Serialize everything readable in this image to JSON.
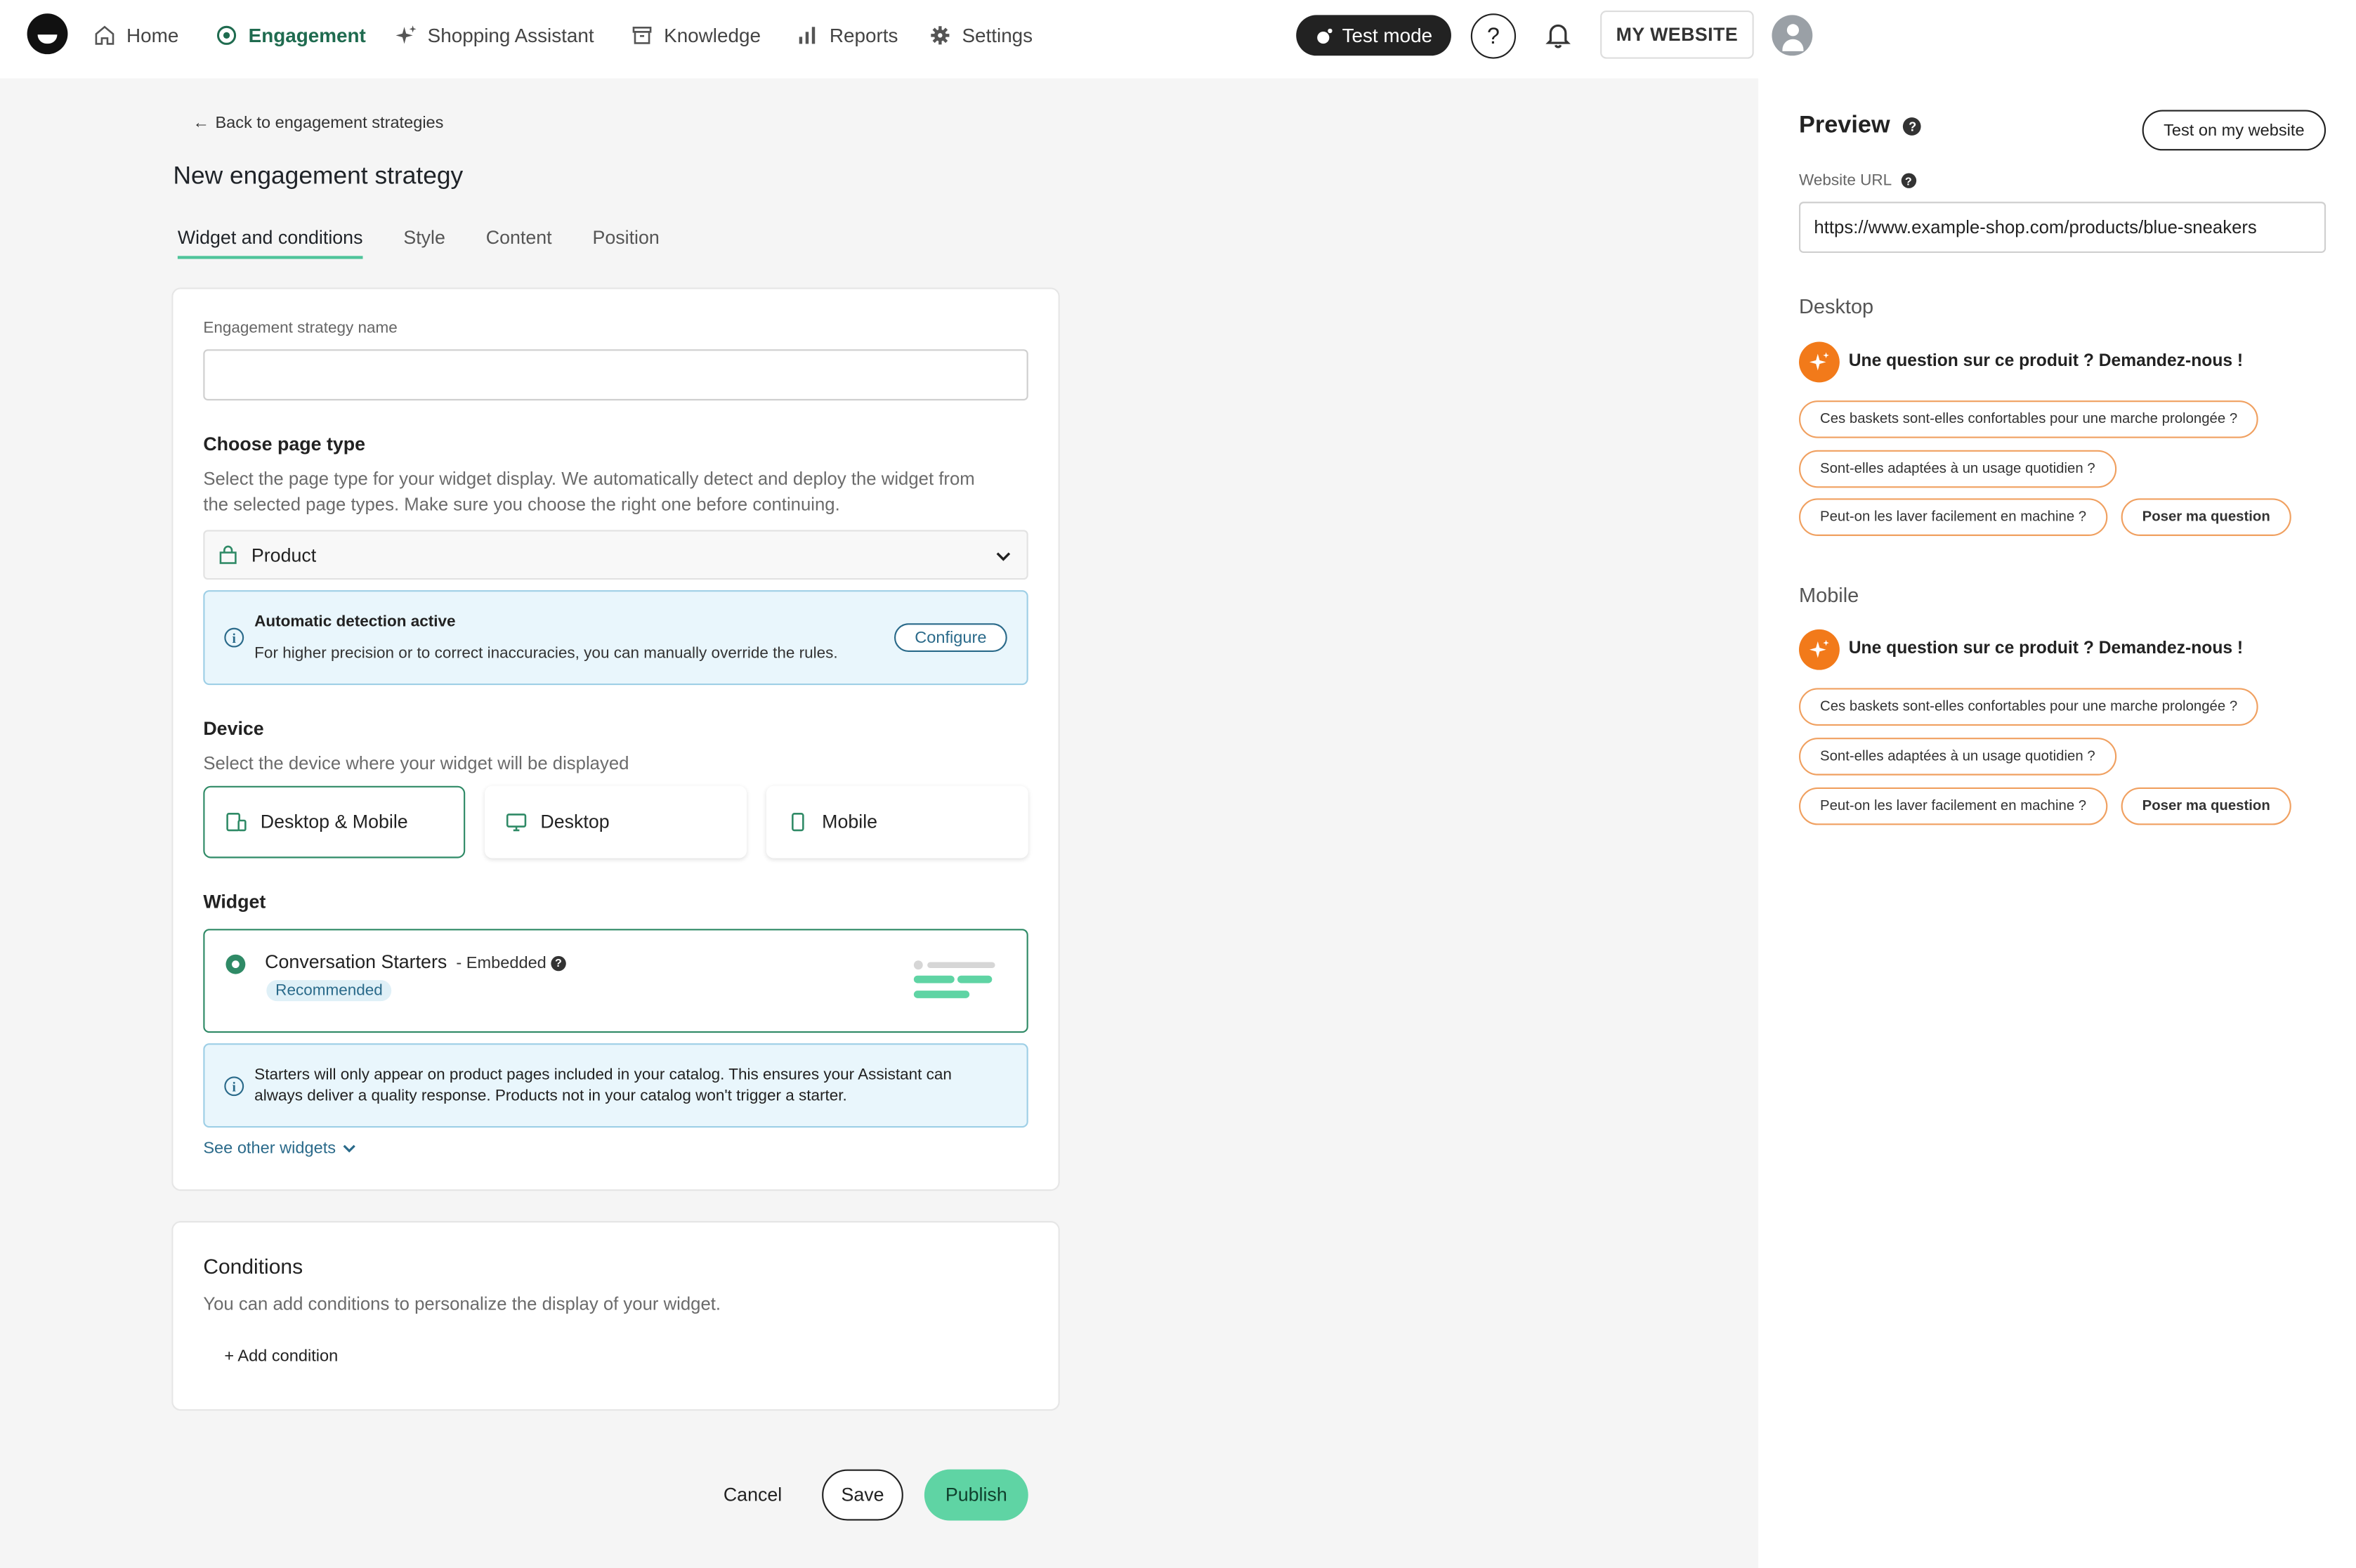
{
  "nav": {
    "items": [
      {
        "label": "Home",
        "icon": "home-icon"
      },
      {
        "label": "Engagement",
        "icon": "target-icon"
      },
      {
        "label": "Shopping Assistant",
        "icon": "sparkle-icon"
      },
      {
        "label": "Knowledge",
        "icon": "archive-icon"
      },
      {
        "label": "Reports",
        "icon": "bar-chart-icon"
      },
      {
        "label": "Settings",
        "icon": "gear-icon"
      }
    ],
    "test_mode_label": "Test mode",
    "help_label": "?",
    "website_label": "MY WEBSITE"
  },
  "page": {
    "back_label": "Back to engagement strategies",
    "title": "New engagement strategy",
    "tabs": [
      "Widget and conditions",
      "Style",
      "Content",
      "Position"
    ],
    "active_tab": "Widget and conditions"
  },
  "form": {
    "name_label": "Engagement strategy name",
    "name_value": "",
    "page_type_heading": "Choose page type",
    "page_type_desc_1": "Select the page type for your widget display. We automatically detect and deploy the widget from",
    "page_type_desc_2": "the selected page types. Make sure you choose the right one before continuing.",
    "page_type_value": "Product",
    "detection_title": "Automatic detection active",
    "detection_text": "For higher precision or to correct inaccuracies, you can manually override the rules.",
    "configure_label": "Configure",
    "device_heading": "Device",
    "device_desc": "Select the device where your widget will be displayed",
    "devices": [
      "Desktop & Mobile",
      "Desktop",
      "Mobile"
    ],
    "selected_device": "Desktop & Mobile",
    "widget_heading": "Widget",
    "widget_name": "Conversation Starters",
    "widget_type": "- Embedded",
    "widget_badge": "Recommended",
    "starter_note_1": "Starters will only appear on product pages included in your catalog. This ensures your Assistant can",
    "starter_note_2": "always deliver a quality response. Products not in your catalog won't trigger a starter.",
    "see_other_label": "See other widgets"
  },
  "conditions": {
    "heading": "Conditions",
    "desc": "You can add conditions to personalize the display of your widget.",
    "add_label": "Add condition"
  },
  "actions": {
    "cancel": "Cancel",
    "save": "Save",
    "publish": "Publish"
  },
  "preview": {
    "title": "Preview",
    "test_button": "Test on my website",
    "url_label": "Website URL",
    "url_value": "https://www.example-shop.com/products/blue-sneakers",
    "desktop_label": "Desktop",
    "mobile_label": "Mobile",
    "question_title": "Une question sur ce produit ? Demandez-nous !",
    "chips": [
      "Ces baskets sont-elles confortables pour une marche prolongée ?",
      "Sont-elles adaptées à un usage quotidien ?",
      "Peut-on les laver facilement en machine ?"
    ],
    "ask_label": "Poser ma question"
  },
  "colors": {
    "accent": "#2f8a66",
    "publish": "#5fd4a4",
    "spark": "#f27a1a",
    "info_bg": "#e9f6fc"
  }
}
